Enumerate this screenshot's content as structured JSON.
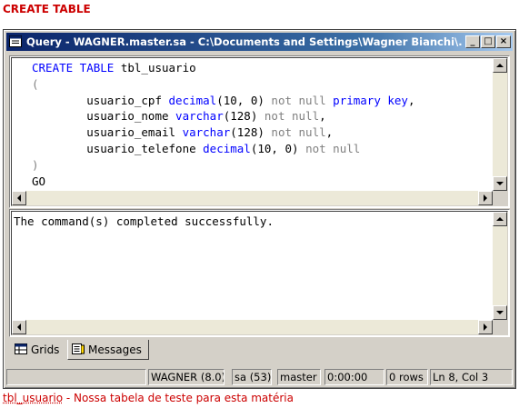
{
  "heading": "CREATE TABLE",
  "window": {
    "title": "Query - WAGNER.master.sa - C:\\Documents and Settings\\Wagner Bianchi\\...",
    "buttons": {
      "minimize": "_",
      "maximize": "□",
      "close": "×"
    }
  },
  "editor": {
    "lines": [
      [
        {
          "t": "CREATE TABLE",
          "c": "kw"
        },
        {
          "t": " tbl_usuario",
          "c": ""
        }
      ],
      [
        {
          "t": "(",
          "c": "gray"
        }
      ],
      [
        {
          "t": "        usuario_cpf ",
          "c": ""
        },
        {
          "t": "decimal",
          "c": "kw"
        },
        {
          "t": "(10, 0) ",
          "c": ""
        },
        {
          "t": "not null",
          "c": "gray"
        },
        {
          "t": " ",
          "c": ""
        },
        {
          "t": "primary key",
          "c": "kw"
        },
        {
          "t": ",",
          "c": ""
        }
      ],
      [
        {
          "t": "        usuario_nome ",
          "c": ""
        },
        {
          "t": "varchar",
          "c": "kw"
        },
        {
          "t": "(128) ",
          "c": ""
        },
        {
          "t": "not null",
          "c": "gray"
        },
        {
          "t": ",",
          "c": ""
        }
      ],
      [
        {
          "t": "        usuario_email ",
          "c": ""
        },
        {
          "t": "varchar",
          "c": "kw"
        },
        {
          "t": "(128) ",
          "c": ""
        },
        {
          "t": "not null",
          "c": "gray"
        },
        {
          "t": ",",
          "c": ""
        }
      ],
      [
        {
          "t": "        usuario_telefone ",
          "c": ""
        },
        {
          "t": "decimal",
          "c": "kw"
        },
        {
          "t": "(10, 0) ",
          "c": ""
        },
        {
          "t": "not null",
          "c": "gray"
        }
      ],
      [
        {
          "t": ")",
          "c": "gray"
        }
      ],
      [
        {
          "t": "GO",
          "c": ""
        }
      ]
    ]
  },
  "results": {
    "message": "The command(s) completed successfully."
  },
  "tabs": [
    {
      "label": "Grids",
      "icon": "grid-icon",
      "active": false
    },
    {
      "label": "Messages",
      "icon": "messages-icon",
      "active": true
    }
  ],
  "status": {
    "server": "WAGNER (8.0)",
    "user": "sa (53)",
    "database": "master",
    "time": "0:00:00",
    "rows": "0 rows",
    "position": "Ln 8, Col 3"
  },
  "caption": {
    "table_name": "tbl_usuario",
    "text": " - Nossa tabela de teste para esta matéria"
  },
  "colors": {
    "keyword": "#0000ff",
    "muted": "#808080",
    "heading": "#cc0000",
    "titlebar_start": "#0a246a",
    "titlebar_end": "#a6caf0"
  }
}
